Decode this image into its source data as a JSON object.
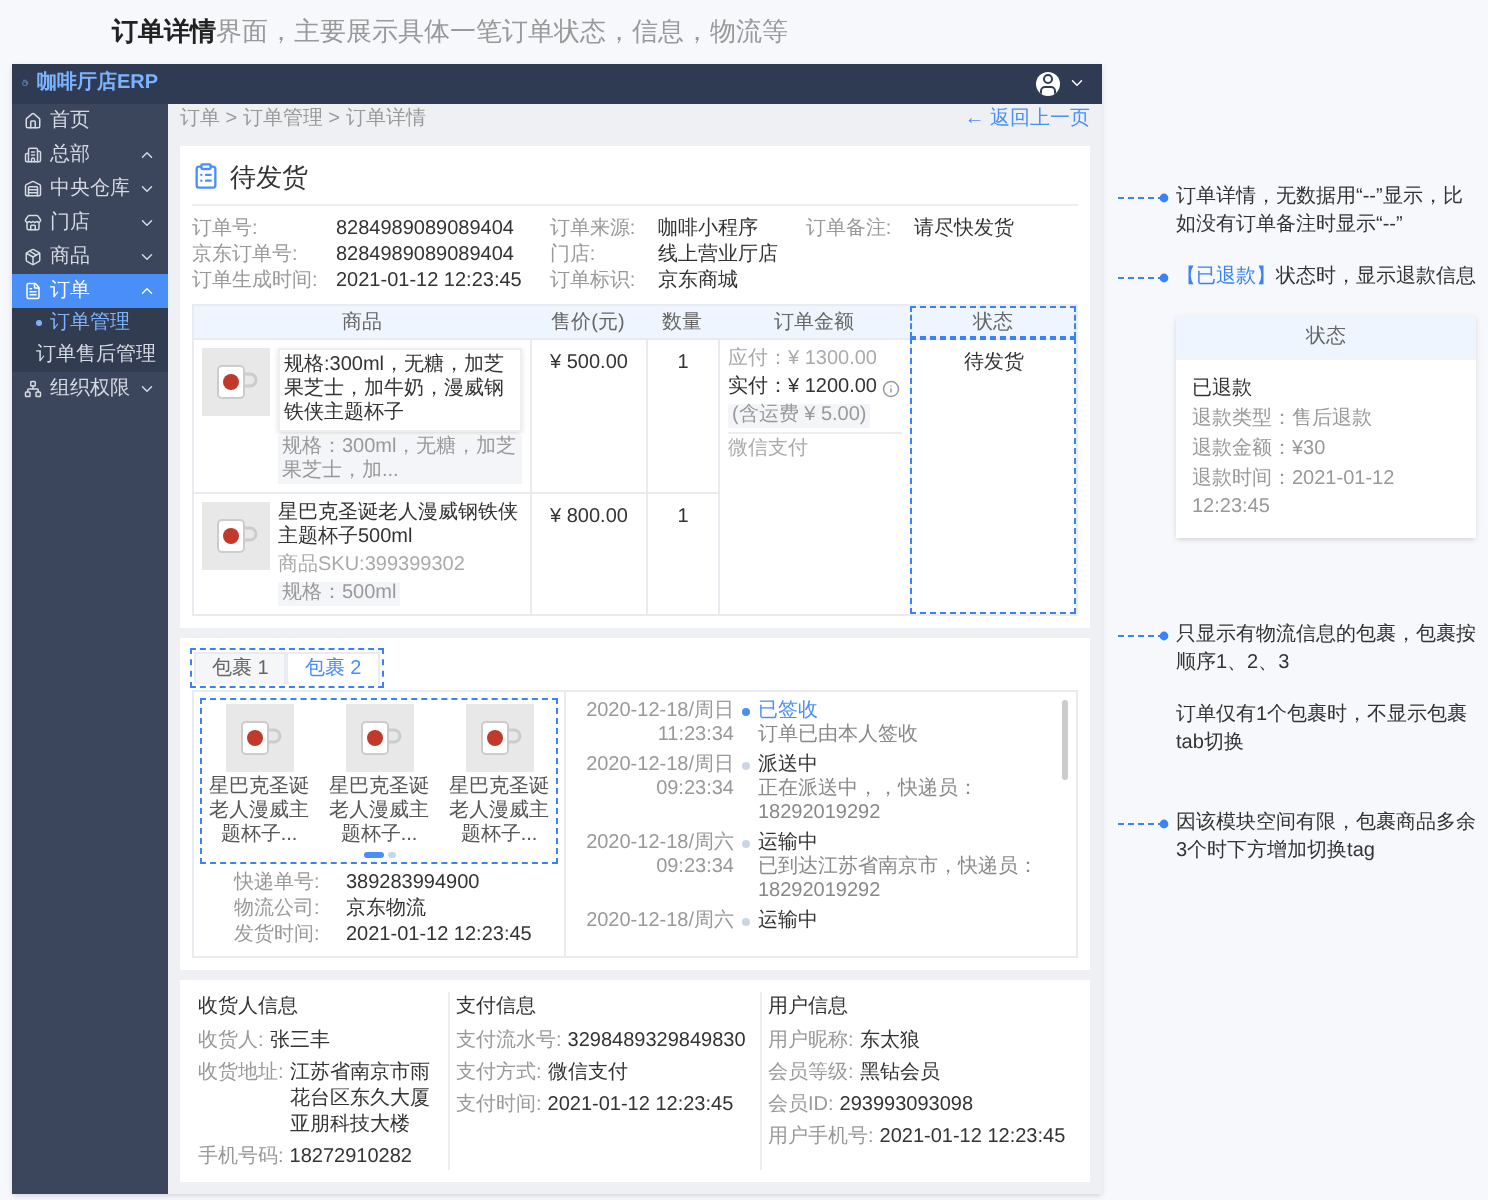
{
  "heading": "**订单详情**界面，主要展示具体一笔订单状态，信息，物流等",
  "app": {
    "brand": "咖啡厅店ERP",
    "menu": [
      {
        "label": "首页",
        "kind": "link",
        "selected": false
      },
      {
        "label": "总部",
        "kind": "group",
        "expanded": true,
        "selected": false
      },
      {
        "label": "中央仓库",
        "kind": "group",
        "expanded": false,
        "selected": false
      },
      {
        "label": "门店",
        "kind": "group",
        "expanded": false,
        "selected": false
      },
      {
        "label": "商品",
        "kind": "group",
        "expanded": false,
        "selected": false
      },
      {
        "label": "订单",
        "kind": "group",
        "expanded": true,
        "selected": true,
        "children": [
          {
            "label": "订单管理",
            "selected": true
          },
          {
            "label": "订单售后管理",
            "selected": false
          }
        ]
      },
      {
        "label": "组织权限",
        "kind": "group",
        "expanded": false,
        "selected": false
      }
    ],
    "breadcrumb": "订单 > 订单管理 > 订单详情",
    "back": "← 返回上一页",
    "status_title": "待发货",
    "info": [
      [
        {
          "label": "订单号:",
          "value": "8284989089089404"
        },
        {
          "label": "京东订单号:",
          "value": "8284989089089404"
        },
        {
          "label": "订单生成时间:",
          "value": "2021-01-12 12:23:45"
        }
      ],
      [
        {
          "label": "订单来源:",
          "value": "咖啡小程序"
        },
        {
          "label": "门店:",
          "value": "线上营业厅店"
        },
        {
          "label": "订单标识:",
          "value": "京东商城"
        }
      ],
      [
        {
          "label": "订单备注:",
          "value": "请尽快发货"
        }
      ]
    ],
    "table": {
      "columns": [
        "商品",
        "售价(元)",
        "数量",
        "订单金额",
        "状态"
      ],
      "rows": [
        {
          "tooltip": "规格:300ml，无糖，加芝果芝士，加牛奶，漫威钢铁侠主题杯子",
          "spec": "规格：300ml，无糖，加芝果芝士，加...",
          "price": "¥ 500.00",
          "qty": "1"
        },
        {
          "name": "星巴克圣诞老人漫威钢铁侠主题杯子500ml",
          "sku": "商品SKU:399399302",
          "spec": "规格：500ml",
          "price": "¥ 800.00",
          "qty": "1"
        }
      ],
      "payable": "应付：¥ 1300.00",
      "paid": "实付：¥ 1200.00",
      "freight": "(含运费 ¥ 5.00)",
      "pay_method": "微信支付",
      "status": "待发货"
    },
    "packages": {
      "tabs": [
        {
          "label": "包裹 1",
          "selected": false
        },
        {
          "label": "包裹 2",
          "selected": true
        }
      ],
      "items": [
        "星巴克圣诞老人漫威主题杯子...",
        "星巴克圣诞老人漫威主题杯子...",
        "星巴克圣诞老人漫威主题杯子..."
      ],
      "pages": [
        {
          "selected": true
        },
        {
          "selected": false
        }
      ],
      "info": [
        {
          "label": "快递单号:",
          "value": "389283994900"
        },
        {
          "label": "物流公司:",
          "value": "京东物流"
        },
        {
          "label": "发货时间:",
          "value": "2021-01-12 12:23:45"
        }
      ],
      "timeline": [
        {
          "date": "2020-12-18/周日",
          "time": "11:23:34",
          "title": "已签收",
          "detail": "订单已由本人签收",
          "active": true
        },
        {
          "date": "2020-12-18/周日",
          "time": "09:23:34",
          "title": "派送中",
          "detail": "正在派送中，，快递员：18292019292",
          "active": false
        },
        {
          "date": "2020-12-18/周六",
          "time": "09:23:34",
          "title": "运输中",
          "detail": "已到达江苏省南京市，快递员：18292019292",
          "active": false
        },
        {
          "date": "2020-12-18/周六",
          "title": "运输中",
          "active": false
        }
      ]
    },
    "details": [
      {
        "title": "收货人信息",
        "rows": [
          {
            "label": "收货人:",
            "value": "张三丰"
          },
          {
            "label": "收货地址:",
            "value": "江苏省南京市雨花台区东久大厦亚朋科技大楼"
          },
          {
            "label": "手机号码:",
            "value": "18272910282"
          }
        ]
      },
      {
        "title": "支付信息",
        "rows": [
          {
            "label": "支付流水号:",
            "value": "3298489329849830"
          },
          {
            "label": "支付方式:",
            "value": "微信支付"
          },
          {
            "label": "支付时间:",
            "value": "2021-01-12 12:23:45"
          }
        ]
      },
      {
        "title": "用户信息",
        "rows": [
          {
            "label": "用户昵称:",
            "value": "东太狼"
          },
          {
            "label": "会员等级:",
            "value": "黑钻会员"
          },
          {
            "label": "会员ID:",
            "value": "293993093098"
          },
          {
            "label": "用户手机号:",
            "value": "2021-01-12 12:23:45"
          }
        ]
      }
    ]
  },
  "notes": {
    "note_1": "订单详情，无数据用“--”显示，比如没有订单备注时显示“--”",
    "refund_tag": "【已退款】",
    "refund_note": "状态时，显示退款信息",
    "refund_card": {
      "header": "状态",
      "status": "已退款",
      "lines": [
        "退款类型：售后退款",
        "退款金额：¥30",
        "退款时间：2021-01-12 12:23:45"
      ]
    },
    "note_3": "只显示有物流信息的包裹，包裹按顺序1、2、3",
    "note_4": "订单仅有1个包裹时，不显示包裹tab切换",
    "note_5": "因该模块空间有限，包裹商品多余3个时下方增加切换tag"
  }
}
